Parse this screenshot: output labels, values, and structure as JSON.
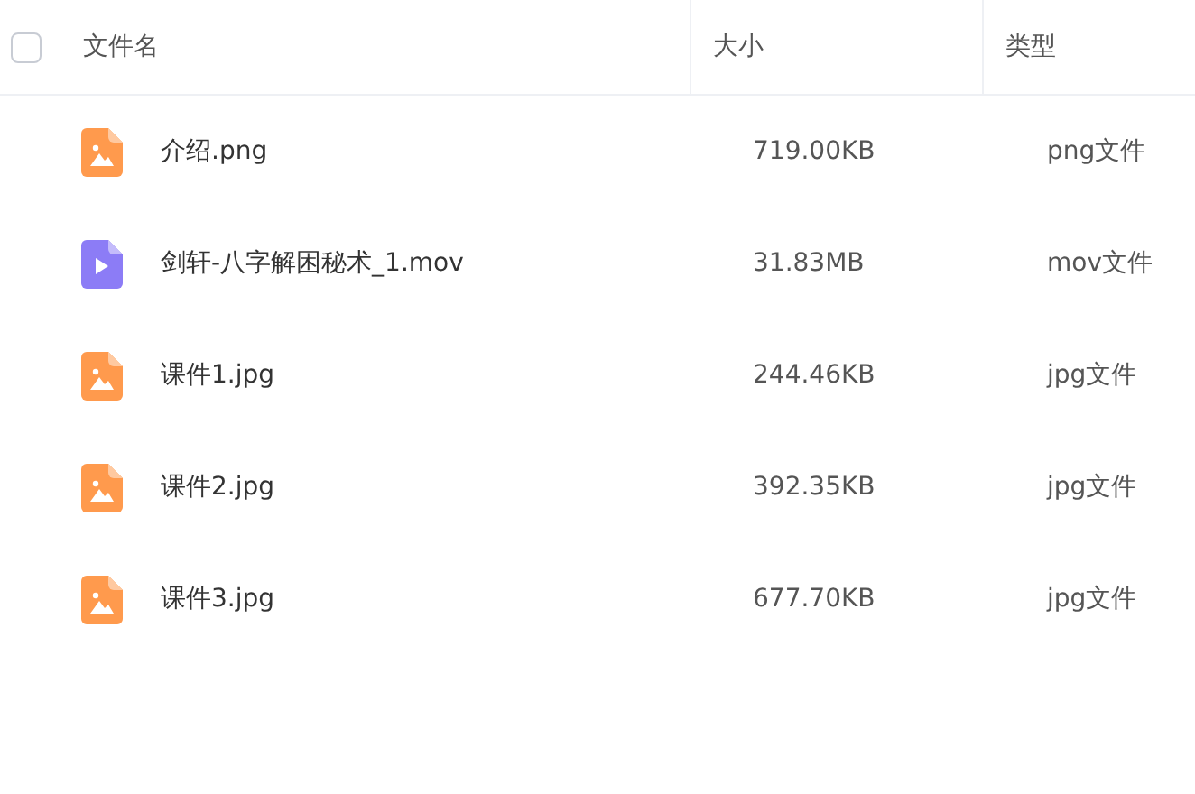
{
  "table": {
    "select_all": {
      "checked": false
    },
    "columns": [
      "文件名",
      "大小",
      "类型"
    ],
    "rows": [
      {
        "kind": "image",
        "name": "介绍.png",
        "size": "719.00KB",
        "type": "png文件"
      },
      {
        "kind": "video",
        "name": "剑轩-八字解困秘术_1.mov",
        "size": "31.83MB",
        "type": "mov文件"
      },
      {
        "kind": "image",
        "name": "课件1.jpg",
        "size": "244.46KB",
        "type": "jpg文件"
      },
      {
        "kind": "image",
        "name": "课件2.jpg",
        "size": "392.35KB",
        "type": "jpg文件"
      },
      {
        "kind": "image",
        "name": "课件3.jpg",
        "size": "677.70KB",
        "type": "jpg文件"
      }
    ]
  }
}
